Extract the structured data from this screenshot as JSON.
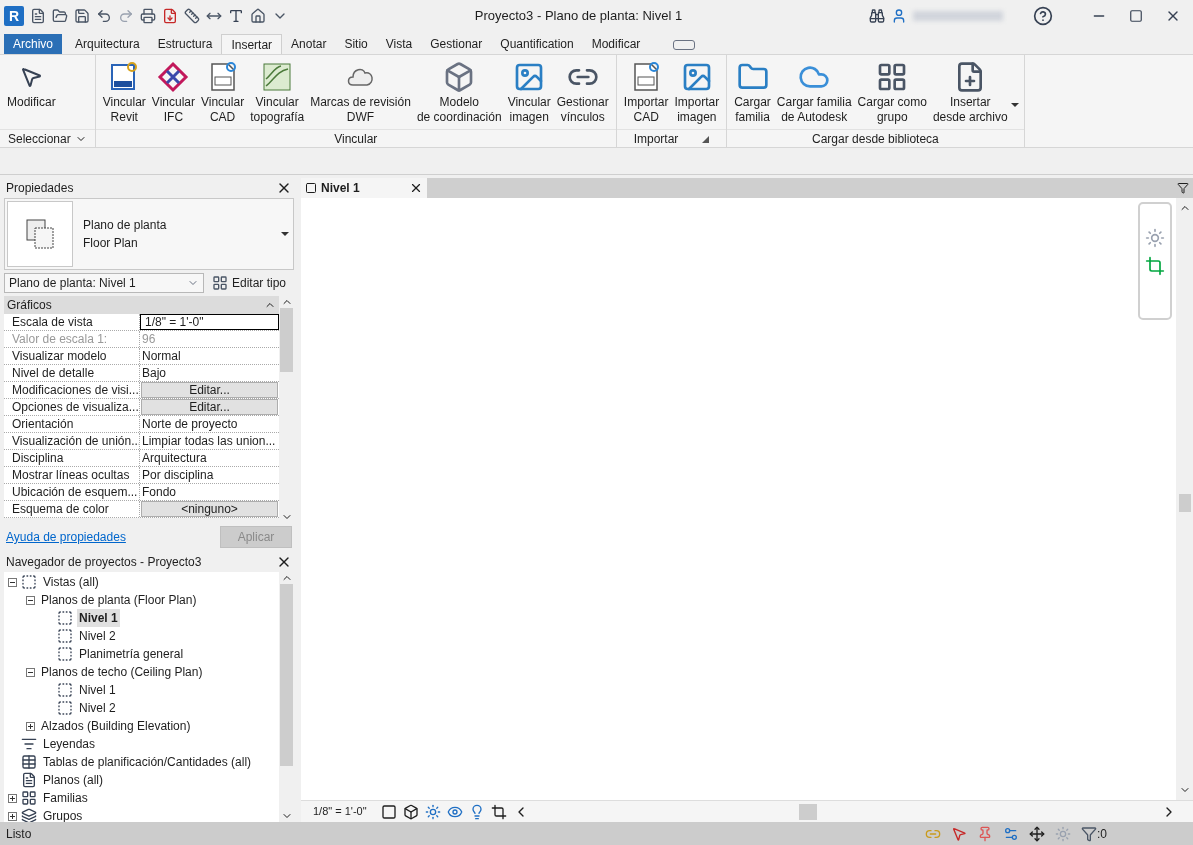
{
  "app_logo": "R",
  "window": {
    "title": "Proyecto3 - Plano de planta: Nivel 1"
  },
  "tabs": [
    {
      "label": "Archivo",
      "selected": false,
      "kind": "file"
    },
    {
      "label": "Arquitectura",
      "selected": false,
      "kind": "tab"
    },
    {
      "label": "Estructura",
      "selected": false,
      "kind": "tab"
    },
    {
      "label": "Insertar",
      "selected": true,
      "kind": "tab"
    },
    {
      "label": "Anotar",
      "selected": false,
      "kind": "tab"
    },
    {
      "label": "Sitio",
      "selected": false,
      "kind": "tab"
    },
    {
      "label": "Vista",
      "selected": false,
      "kind": "tab"
    },
    {
      "label": "Gestionar",
      "selected": false,
      "kind": "tab"
    },
    {
      "label": "Quantification",
      "selected": false,
      "kind": "tab"
    },
    {
      "label": "Modificar",
      "selected": false,
      "kind": "tab"
    }
  ],
  "ribbon_panels": [
    {
      "title": "Seleccionar",
      "menu": true,
      "launcher": false,
      "buttons": [
        {
          "label": "Modificar",
          "dropdown": false
        }
      ]
    },
    {
      "title": "Vincular",
      "menu": false,
      "launcher": false,
      "buttons": [
        {
          "label": "Vincular\nRevit",
          "dropdown": false
        },
        {
          "label": "Vincular\nIFC",
          "dropdown": false
        },
        {
          "label": "Vincular\nCAD",
          "dropdown": false
        },
        {
          "label": "Vincular\ntopografía",
          "dropdown": false
        },
        {
          "label": "Marcas de revisión\nDWF",
          "dropdown": false
        },
        {
          "label": "Modelo\nde coordinación",
          "dropdown": false
        },
        {
          "label": "Vincular\nimagen",
          "dropdown": false
        },
        {
          "label": "Gestionar\nvínculos",
          "dropdown": false
        }
      ]
    },
    {
      "title": "Importar",
      "menu": false,
      "launcher": true,
      "buttons": [
        {
          "label": "Importar\nCAD",
          "dropdown": false
        },
        {
          "label": "Importar\nimagen",
          "dropdown": false
        }
      ]
    },
    {
      "title": "Cargar desde biblioteca",
      "menu": false,
      "launcher": false,
      "buttons": [
        {
          "label": "Cargar\nfamilia",
          "dropdown": false
        },
        {
          "label": "Cargar familia\nde Autodesk",
          "dropdown": false
        },
        {
          "label": "Cargar como\ngrupo",
          "dropdown": false
        },
        {
          "label": "Insertar\ndesde archivo",
          "dropdown": true
        }
      ]
    }
  ],
  "properties": {
    "title": "Propiedades",
    "type_name": "Plano de planta",
    "type_subname": "Floor Plan",
    "selector": "Plano de planta: Nivel 1",
    "edit_type": "Editar tipo",
    "group": "Gráficos",
    "rows": [
      {
        "label": "Escala de vista",
        "value": "1/8\" = 1'-0\"",
        "kind": "field",
        "disabled": false
      },
      {
        "label": "Valor de escala    1:",
        "value": "96",
        "kind": "text",
        "disabled": true
      },
      {
        "label": "Visualizar modelo",
        "value": "Normal",
        "kind": "text",
        "disabled": false
      },
      {
        "label": "Nivel de detalle",
        "value": "Bajo",
        "kind": "text",
        "disabled": false
      },
      {
        "label": "Modificaciones de visi...",
        "value": "Editar...",
        "kind": "button",
        "disabled": false
      },
      {
        "label": "Opciones de visualiza...",
        "value": "Editar...",
        "kind": "button",
        "disabled": false
      },
      {
        "label": "Orientación",
        "value": "Norte de proyecto",
        "kind": "text",
        "disabled": false
      },
      {
        "label": "Visualización de unión...",
        "value": "Limpiar todas las union...",
        "kind": "text",
        "disabled": false
      },
      {
        "label": "Disciplina",
        "value": "Arquitectura",
        "kind": "text",
        "disabled": false
      },
      {
        "label": "Mostrar líneas ocultas",
        "value": "Por disciplina",
        "kind": "text",
        "disabled": false
      },
      {
        "label": "Ubicación de esquem...",
        "value": "Fondo",
        "kind": "text",
        "disabled": false
      },
      {
        "label": "Esquema de color",
        "value": "<ninguno>",
        "kind": "button",
        "disabled": false
      }
    ],
    "help_link": "Ayuda de propiedades",
    "apply": {
      "label": "Aplicar",
      "disabled": true
    }
  },
  "browser": {
    "title": "Navegador de proyectos - Proyecto3",
    "items": [
      {
        "label": "Vistas (all)",
        "kind": "views",
        "expanded": true,
        "selected": false,
        "children": [
          {
            "label": "Planos de planta (Floor Plan)",
            "expanded": true,
            "selected": false,
            "children": [
              {
                "label": "Nivel 1",
                "kind": "view",
                "selected": true
              },
              {
                "label": "Nivel 2",
                "kind": "view",
                "selected": false
              },
              {
                "label": "Planimetría general",
                "kind": "view",
                "selected": false
              }
            ]
          },
          {
            "label": "Planos de techo (Ceiling Plan)",
            "expanded": true,
            "selected": false,
            "children": [
              {
                "label": "Nivel 1",
                "kind": "view",
                "selected": false
              },
              {
                "label": "Nivel 2",
                "kind": "view",
                "selected": false
              }
            ]
          },
          {
            "label": "Alzados (Building Elevation)",
            "expanded": false,
            "selected": false
          }
        ]
      },
      {
        "label": "Leyendas",
        "kind": "legends",
        "selected": false
      },
      {
        "label": "Tablas de planificación/Cantidades (all)",
        "kind": "schedules",
        "selected": false
      },
      {
        "label": "Planos (all)",
        "kind": "sheets",
        "selected": false
      },
      {
        "label": "Familias",
        "kind": "families",
        "expanded": false,
        "selected": false
      },
      {
        "label": "Grupos",
        "kind": "groups",
        "expanded": false,
        "selected": false
      }
    ]
  },
  "view_tab": {
    "label": "Nivel 1",
    "selected": true
  },
  "view_scale": "1/8\" = 1'-0\"",
  "status": {
    "text": "Listo",
    "filter_count": ":0"
  }
}
